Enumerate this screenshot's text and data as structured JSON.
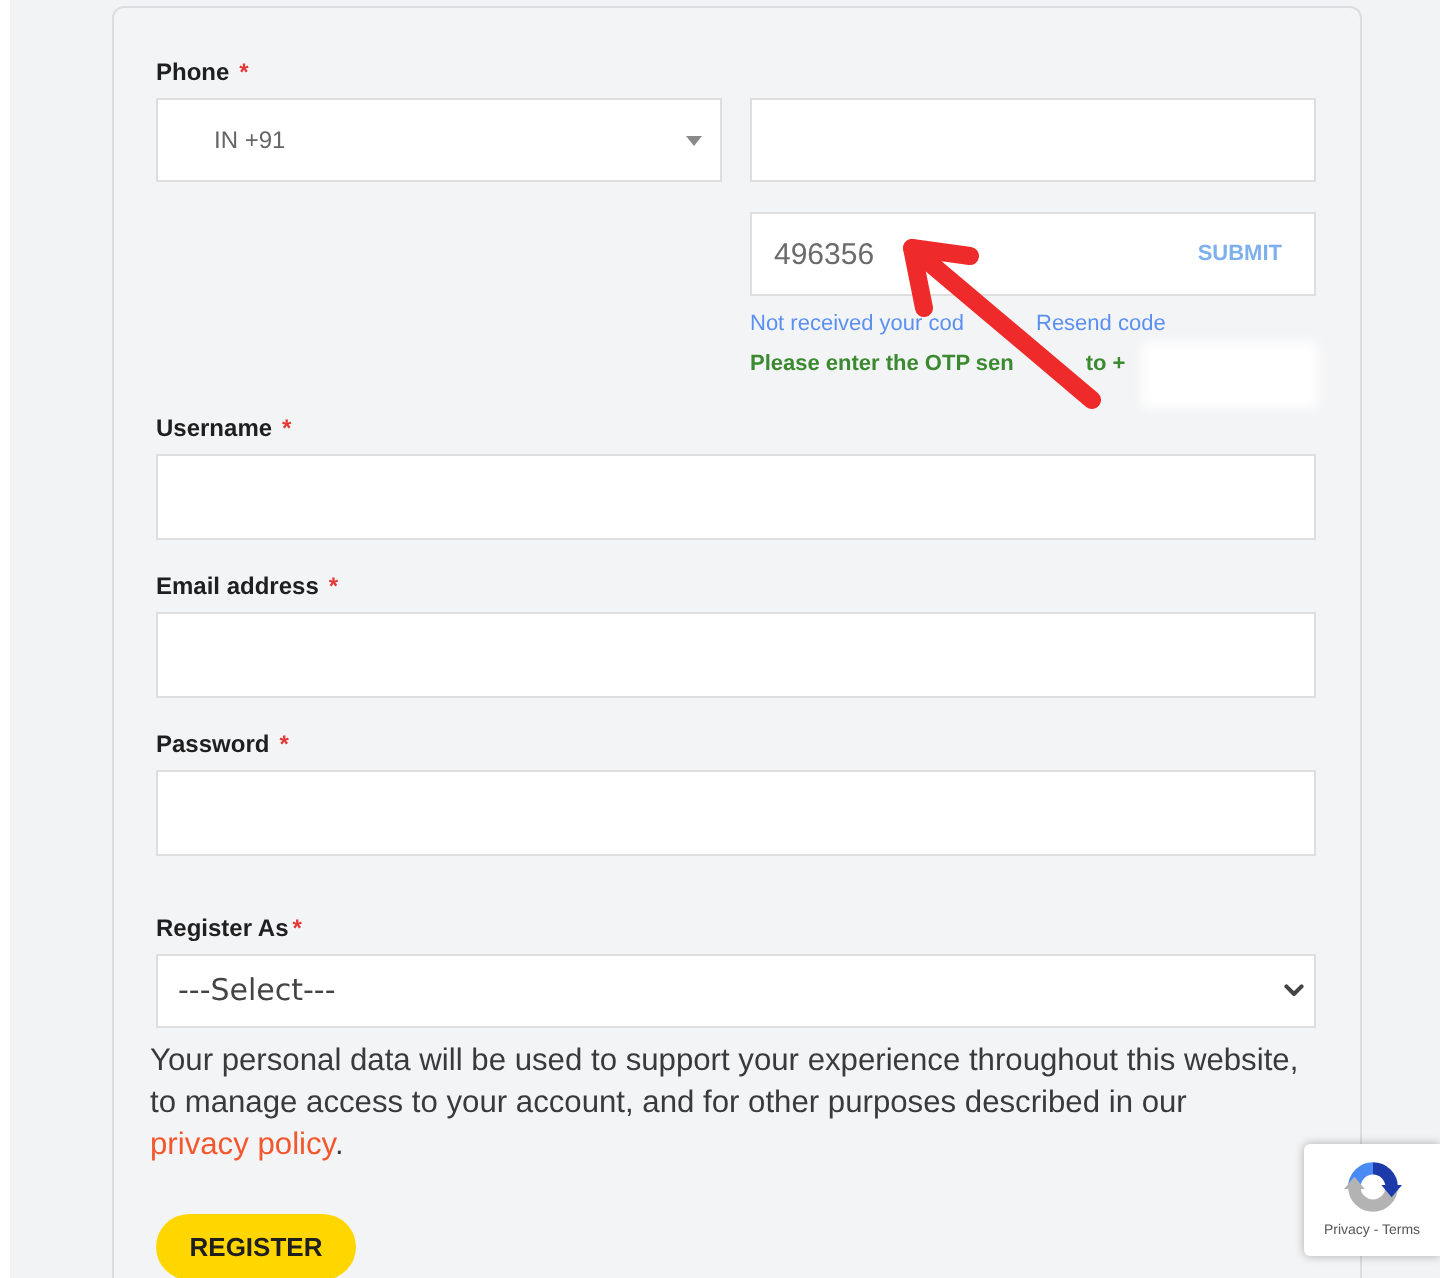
{
  "phone": {
    "label": "Phone",
    "required_mark": "*",
    "country_code": "IN +91"
  },
  "otp": {
    "value": "496356",
    "submit": "SUBMIT",
    "resend_prompt": "Not received your cod",
    "resend_link": "Resend code",
    "status": "Please enter the OTP sen",
    "status_continued": "to +"
  },
  "fields": [
    {
      "label": "Username",
      "required_mark": "*"
    },
    {
      "label": "Email address",
      "required_mark": "*"
    },
    {
      "label": "Password",
      "required_mark": "*"
    }
  ],
  "register_as": {
    "label": "Register As",
    "required_mark": "*",
    "placeholder": "---Select---"
  },
  "privacy_notice": {
    "text": "Your personal data will be used to support your experience throughout this website, to manage access to your account, and for other purposes described in our",
    "link": "privacy policy",
    "text_after": "."
  },
  "register_button": "REGISTER",
  "recaptcha": {
    "links": "Privacy - Terms"
  }
}
